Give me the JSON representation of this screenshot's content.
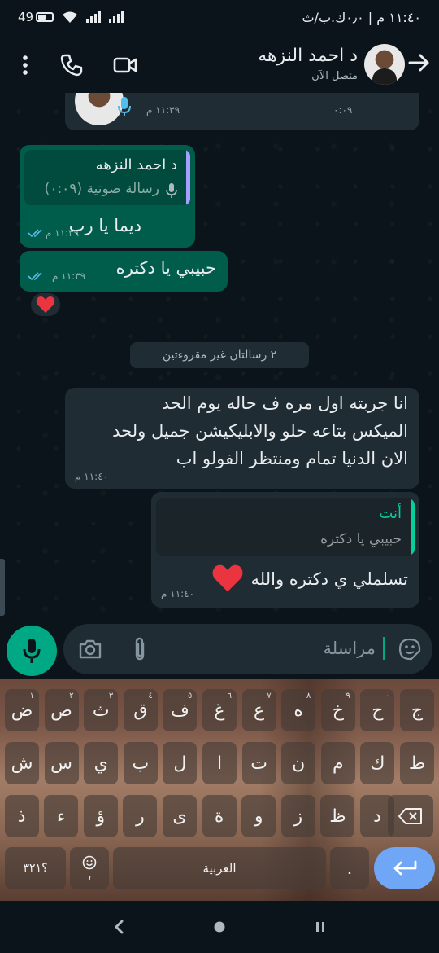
{
  "status_bar": {
    "time": "١١:٤٠ م | ٠٫٠ك.ب/ث",
    "battery": "49",
    "icons": [
      "battery-icon",
      "wifi-icon",
      "signal-icon",
      "signal-icon"
    ]
  },
  "header": {
    "contact_name": "د احمد النزهه",
    "presence": "متصل الآن",
    "icons": [
      "back-arrow-icon",
      "video-call-icon",
      "voice-call-icon",
      "menu-dots-icon"
    ]
  },
  "messages": {
    "voice_partial": {
      "duration": "٠:٠٩",
      "time": "١١:٣٩ م"
    },
    "reply_1": {
      "quote_name": "د احمد النزهه",
      "quote_text": "رسالة صوتية (٠:٠٩)",
      "text": "ديما يا رب",
      "time": "١١:٣٩ م"
    },
    "msg_2": {
      "text": "حبيبي يا دكتره",
      "time": "١١:٣٩ م",
      "reaction": "❤️"
    },
    "unread_banner": "٢ رسالتان غير مقروءتين",
    "incoming_1": {
      "lines": [
        "انا جربته اول مره ف حاله يوم الحد",
        "الميكس بتاعه حلو والابليكيشن جميل ولحد",
        "الان الدنيا تمام ومنتظر الفولو اب"
      ],
      "time": "١١:٤٠ م"
    },
    "incoming_2": {
      "quote_name": "أنت",
      "quote_text": "حبيبي يا دكتره",
      "text": "تسلملي ي دكتره والله",
      "emoji": "❤️",
      "time": "١١:٤٠ م"
    }
  },
  "composer": {
    "placeholder": "مراسلة"
  },
  "keyboard": {
    "row1": [
      {
        "k": "ج",
        "h": ""
      },
      {
        "k": "ح",
        "h": "٠"
      },
      {
        "k": "خ",
        "h": "٩"
      },
      {
        "k": "ه",
        "h": "٨"
      },
      {
        "k": "ع",
        "h": "٧"
      },
      {
        "k": "غ",
        "h": "٦"
      },
      {
        "k": "ف",
        "h": "٥"
      },
      {
        "k": "ق",
        "h": "٤"
      },
      {
        "k": "ث",
        "h": "٣"
      },
      {
        "k": "ص",
        "h": "٢"
      },
      {
        "k": "ض",
        "h": "١"
      }
    ],
    "row2": [
      "ط",
      "ك",
      "م",
      "ن",
      "ت",
      "ا",
      "ل",
      "ب",
      "ي",
      "س",
      "ش"
    ],
    "row3": [
      "د",
      "ظ",
      "ز",
      "و",
      "ة",
      "ى",
      "ر",
      "ؤ",
      "ء",
      "ذ"
    ],
    "symbols": "؟٣٢١",
    "space_label": "العربية",
    "dot_key": ".",
    "comma_key": "،"
  },
  "nav": {
    "icons": [
      "recents-icon",
      "home-icon",
      "back-icon"
    ]
  },
  "colors": {
    "accent": "#00a884",
    "outgoing_bubble": "#005c4b",
    "incoming_bubble": "#202c33",
    "ticks": "#53bdeb"
  }
}
